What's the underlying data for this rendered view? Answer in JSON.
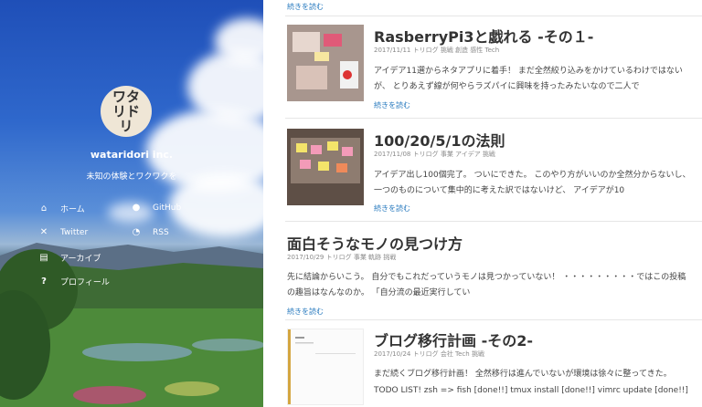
{
  "sidebar": {
    "logo_text": "ワタリドリ",
    "site_name": "wataridori inc.",
    "tagline": "未知の体験とワクワクを",
    "nav": [
      {
        "label": "ホーム",
        "icon": "home-icon"
      },
      {
        "label": "GitHub",
        "icon": "github-icon"
      },
      {
        "label": "Twitter",
        "icon": "twitter-icon"
      },
      {
        "label": "RSS",
        "icon": "rss-icon"
      },
      {
        "label": "アーカイブ",
        "icon": "archive-icon"
      },
      {
        "label": "プロフィール",
        "icon": "question-icon"
      }
    ]
  },
  "main": {
    "top_more": "続きを読む",
    "posts": [
      {
        "title": "RasberryPi3と戯れる -その１-",
        "date": "2017/11/11",
        "tags": "トリログ 挑戦 創造 感性 Tech",
        "excerpt": "アイデア11選からネタアプリに着手！ まだ全然絞り込みをかけているわけではないが、 とりあえず線が何やらラズパイに興味を持ったみたいなので二人で",
        "more": "続きを読む"
      },
      {
        "title": "100/20/5/1の法則",
        "date": "2017/11/08",
        "tags": "トリログ 事業 アイデア 挑戦",
        "excerpt": "アイデア出し100個完了。 ついにできた。 このやり方がいいのか全然分からないし、 一つのものについて集中的に考えた訳ではないけど、 アイデアが10",
        "more": "続きを読む"
      },
      {
        "title": "面白そうなモノの見つけ方",
        "date": "2017/10/29",
        "tags": "トリログ 事業 軌跡 挑戦",
        "excerpt": "先に結論からいこう。 自分でもこれだっていうモノは見つかっていない！ ・・・・・・・・・ではこの投稿の趣旨はなんなのか。 「自分流の最近実行してい",
        "more": "続きを読む"
      },
      {
        "title": "ブログ移行計画 -その2-",
        "date": "2017/10/24",
        "tags": "トリログ 会社 Tech 挑戦",
        "excerpt_1": "まだ続くブログ移行計画！ 全然移行は進んでいないが環境は徐々に整ってきた。",
        "excerpt_2": "TODO LIST! zsh => fish [done!!] tmux install [done!!] vimrc update [done!!]"
      }
    ]
  }
}
